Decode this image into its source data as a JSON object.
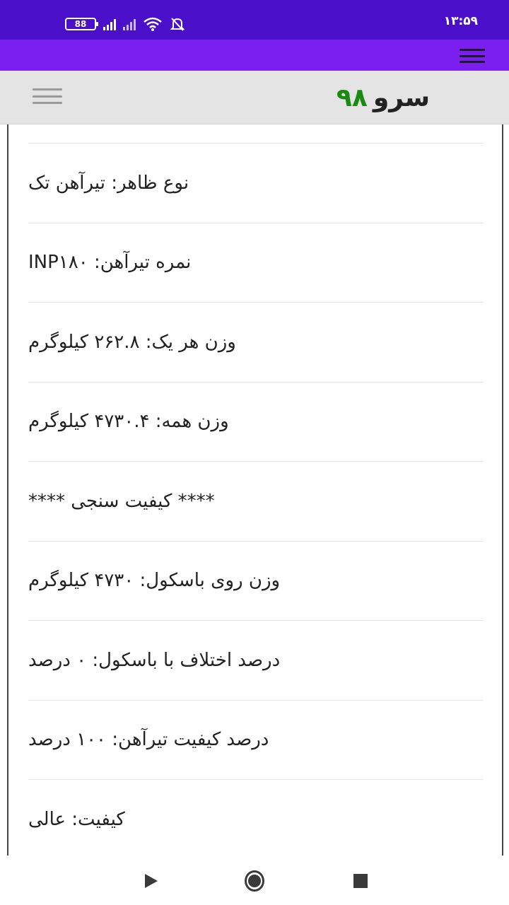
{
  "status_bar": {
    "battery": "88",
    "time": "۱۳:۵۹",
    "icons": [
      "battery-icon",
      "signal-icon",
      "signal-icon",
      "wifi-icon",
      "bell-off-icon"
    ]
  },
  "header": {
    "logo_word": "سرو",
    "logo_number": "۹۸",
    "menu_icon": "hamburger-icon"
  },
  "rows": [
    {
      "text": "نوع ظاهر: تیرآهن تک"
    },
    {
      "text": "نمره تیرآهن: INP۱۸۰"
    },
    {
      "text": "وزن هر یک: ۲۶۲.۸ کیلوگرم"
    },
    {
      "text": "وزن همه: ۴۷۳۰.۴ کیلوگرم"
    },
    {
      "text": "**** کیفیت سنجی ****"
    },
    {
      "text": "وزن روی باسکول: ۴۷۳۰ کیلوگرم"
    },
    {
      "text": "درصد اختلاف با باسکول: ۰ درصد"
    },
    {
      "text": "درصد کیفیت تیرآهن: ۱۰۰ درصد"
    },
    {
      "text": "کیفیت: عالی"
    }
  ],
  "colors": {
    "status_bar": "#4a0fc9",
    "toolbar": "#7b1ff0",
    "header_bg": "#e4e4e4",
    "logo_number": "#1a8a13"
  },
  "nav": [
    "back-icon",
    "home-icon",
    "recents-icon"
  ]
}
